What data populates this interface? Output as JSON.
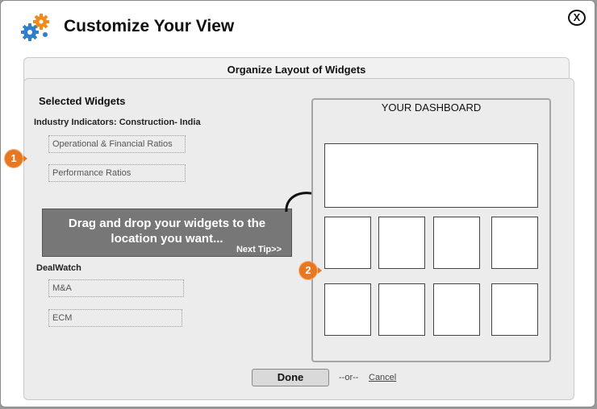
{
  "dialog": {
    "title": "Customize Your View",
    "close_label": "X",
    "logo_icon": "gears-icon"
  },
  "organize": {
    "header": "Organize Layout of Widgets"
  },
  "selected": {
    "title": "Selected Widgets",
    "groups": [
      {
        "title": "Industry Indicators: Construction- India",
        "widgets": [
          "Operational & Financial Ratios",
          "Performance Ratios"
        ]
      },
      {
        "title": "DealWatch",
        "widgets": [
          "M&A",
          "ECM"
        ]
      }
    ]
  },
  "badges": [
    "1",
    "2"
  ],
  "tip": {
    "text": "Drag and drop your widgets to the location you want...",
    "next": "Next Tip>>"
  },
  "dashboard": {
    "title": "YOUR DASHBOARD"
  },
  "footer": {
    "done": "Done",
    "or": "--or--",
    "cancel": "Cancel"
  },
  "colors": {
    "badge": "#e87722",
    "tip_bg": "#777777",
    "panel_bg": "#ececec"
  }
}
